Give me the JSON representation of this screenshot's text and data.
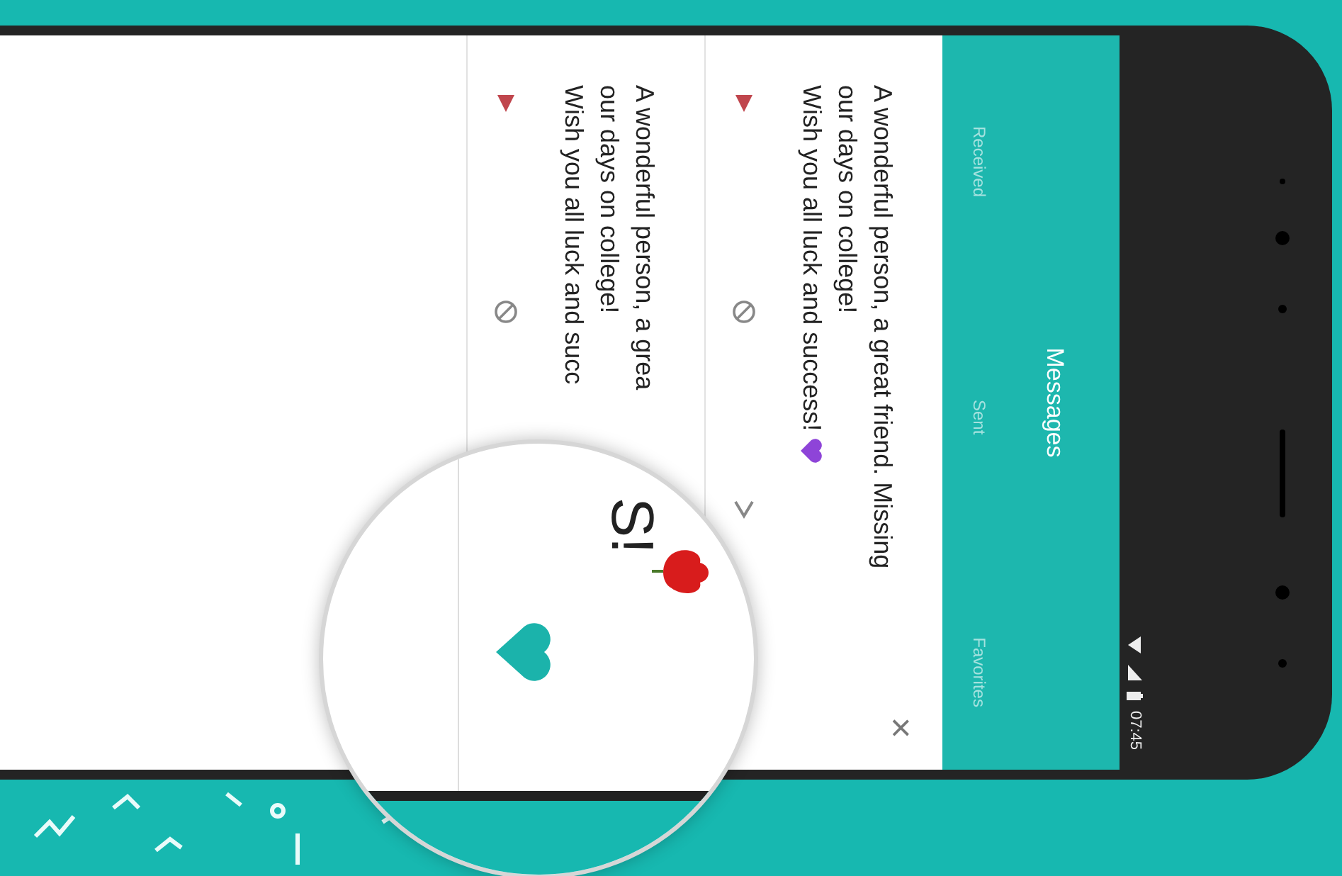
{
  "status_bar": {
    "time": "07:45"
  },
  "app_bar": {
    "title": "Messages"
  },
  "tabs": [
    {
      "label": "Received"
    },
    {
      "label": "Sent"
    },
    {
      "label": "Favorites"
    }
  ],
  "messages": [
    {
      "close": "×",
      "lines": [
        "A wonderful person, a great friend. Missing",
        "our days on college!",
        "Wish you all luck and success!"
      ],
      "heart": true
    },
    {
      "lines": [
        "A wonderful person, a grea",
        "our days on college!",
        "Wish you all luck and succ"
      ],
      "heart": false
    }
  ],
  "magnifier": {
    "text": "S!"
  }
}
